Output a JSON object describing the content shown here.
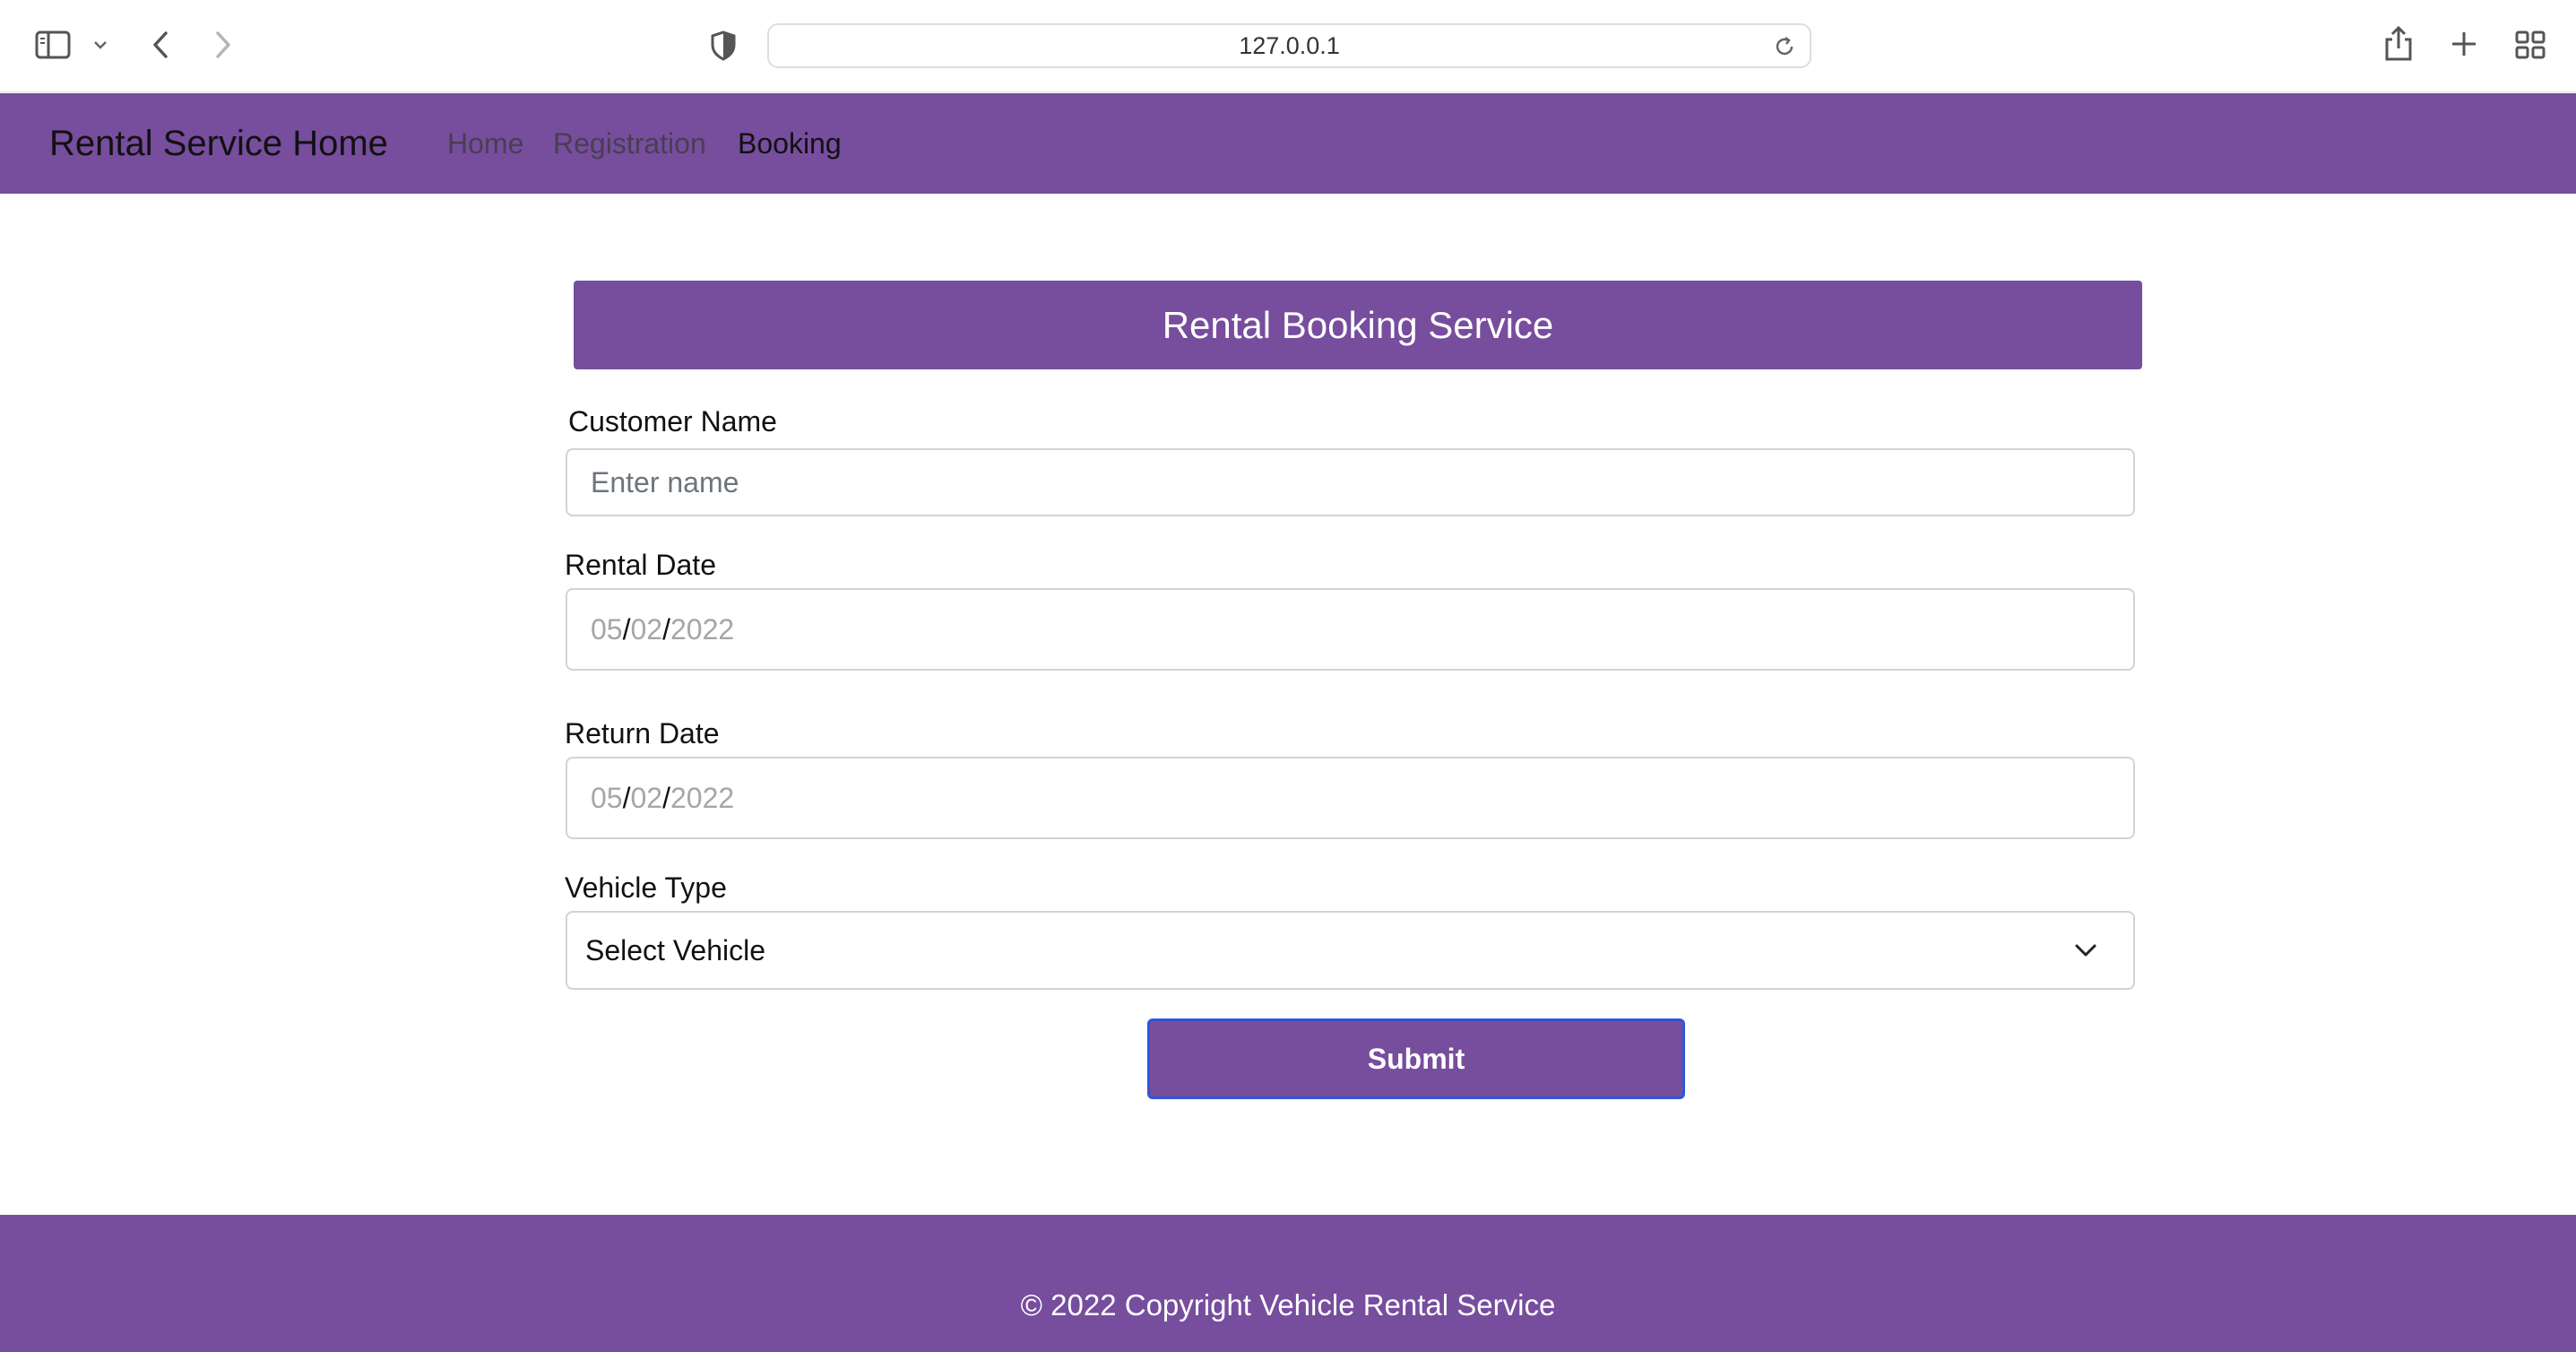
{
  "browser": {
    "url": "127.0.0.1",
    "icons": {
      "sidebar": "sidebar-icon",
      "chevron": "chevron-down-icon",
      "back": "back-arrow-icon",
      "forward": "forward-arrow-icon",
      "privacy": "shield-icon",
      "reload": "reload-icon",
      "share": "share-icon",
      "new_tab": "plus-icon",
      "tab_overview": "grid-icon"
    }
  },
  "navbar": {
    "brand": "Rental Service Home",
    "links": [
      {
        "label": "Home",
        "active": false
      },
      {
        "label": "Registration",
        "active": false
      },
      {
        "label": "Booking",
        "active": true
      }
    ]
  },
  "banner": {
    "title": "Rental Booking Service"
  },
  "form": {
    "customer_name": {
      "label": "Customer Name",
      "placeholder": "Enter name",
      "value": ""
    },
    "rental_date": {
      "label": "Rental Date",
      "month": "05",
      "day": "02",
      "year": "2022",
      "separator": "/"
    },
    "return_date": {
      "label": "Return Date",
      "month": "05",
      "day": "02",
      "year": "2022",
      "separator": "/"
    },
    "vehicle_type": {
      "label": "Vehicle Type",
      "selected": "Select Vehicle"
    },
    "submit_label": "Submit"
  },
  "footer": {
    "text": "© 2022 Copyright Vehicle Rental Service"
  },
  "colors": {
    "brand_purple": "#774d9d",
    "focus_blue": "#2f56d6",
    "white": "#ffffff"
  }
}
